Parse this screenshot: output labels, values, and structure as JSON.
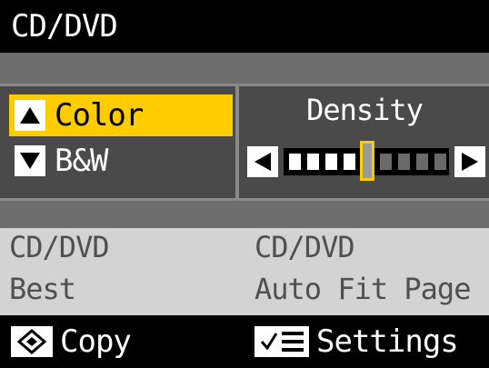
{
  "title": "CD/DVD",
  "mode_options": [
    {
      "label": "Color",
      "selected": true,
      "arrow": "up-arrow-icon"
    },
    {
      "label": "B&W",
      "selected": false,
      "arrow": "down-arrow-icon"
    }
  ],
  "density": {
    "title": "Density",
    "segments": 9,
    "level_index": 4,
    "left_button": "left-arrow-icon",
    "right_button": "right-arrow-icon"
  },
  "info": {
    "col1": [
      "CD/DVD",
      "Best"
    ],
    "col2": [
      "CD/DVD",
      "Auto Fit Page"
    ]
  },
  "bottom": {
    "copy_label": "Copy",
    "copy_icon": "start-diamond-icon",
    "settings_label": "Settings",
    "settings_icon": "settings-list-icon"
  },
  "colors": {
    "highlight": "#ffcc00",
    "background": "#000000",
    "panel": "#4a4a4a",
    "info_bg": "#d3d3d3"
  }
}
